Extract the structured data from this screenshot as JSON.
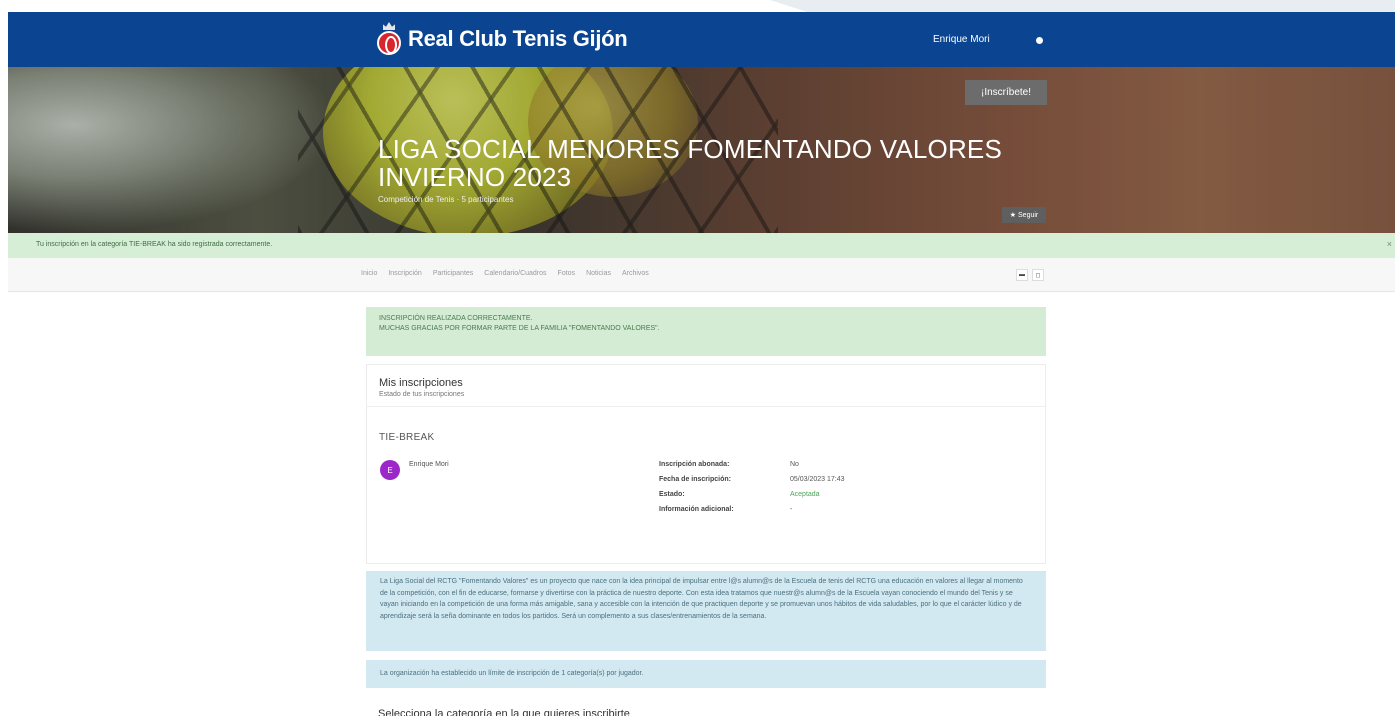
{
  "header": {
    "brand": "Real Club Tenis Gijón",
    "user": "Enrique Mori"
  },
  "hero": {
    "title": "LIGA SOCIAL MENORES FOMENTANDO VALORES INVIERNO 2023",
    "subtitle": "Competición de Tenis · 5 participantes",
    "signup_button": "¡Inscríbete!",
    "follow_button": "Seguir"
  },
  "alert": {
    "text": "Tu inscripción en la categoría TIE-BREAK ha sido registrada correctamente.",
    "close": "×"
  },
  "nav": {
    "items": [
      "Inicio",
      "Inscripción",
      "Participantes",
      "Calendario/Cuadros",
      "Fotos",
      "Noticias",
      "Archivos"
    ]
  },
  "success": {
    "line1": "INSCRIPCIÓN REALIZADA CORRECTAMENTE.",
    "line2": "MUCHAS GRACIAS POR FORMAR PARTE DE LA FAMILIA \"FOMENTANDO VALORES\"."
  },
  "inscriptions": {
    "title": "Mis inscripciones",
    "subtitle": "Estado de tus inscripciones",
    "category": "TIE-BREAK",
    "avatar_letter": "E",
    "person": "Enrique Mori",
    "fields": [
      {
        "label": "Inscripción abonada:",
        "value": "No"
      },
      {
        "label": "Fecha de inscripción:",
        "value": "05/03/2023 17:43"
      },
      {
        "label": "Estado:",
        "value": "Aceptada"
      },
      {
        "label": "Información adicional:",
        "value": "-"
      }
    ]
  },
  "info": {
    "text": "La Liga Social del RCTG \"Fomentando Valores\" es un proyecto que nace con la idea principal de impulsar entre l@s alumn@s de la Escuela de tenis del RCTG una educación en valores al llegar al momento de la competición, con el fin de educarse, formarse y divertirse con la práctica de nuestro deporte. Con esta idea tratamos que nuestr@s alumn@s de la Escuela vayan conociendo el mundo del Tenis y se vayan iniciando en la competición de una forma más amigable, sana y accesible con la intención de que practiquen deporte y se promuevan unos hábitos de vida saludables, por lo que el carácter lúdico y de aprendizaje será la seña dominante en todos los partidos. Será un complemento a sus clases/entrenamientos de la semana."
  },
  "limit": {
    "text": "La organización ha establecido un límite de inscripción de 1 categoría(s) por jugador."
  },
  "select": {
    "title": "Selecciona la categoría en la que quieres inscribirte"
  }
}
